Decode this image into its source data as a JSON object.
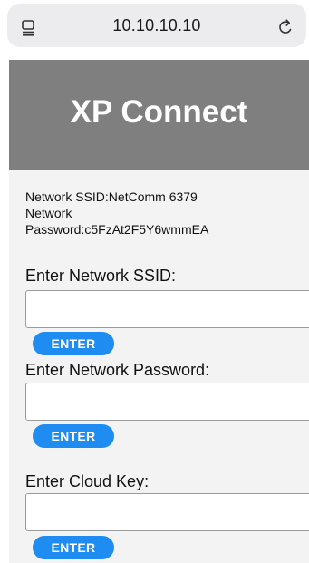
{
  "browser": {
    "url": "10.10.10.10",
    "tab_icon": "tabs-icon",
    "reload_icon": "reload-icon"
  },
  "header": {
    "title": "XP Connect"
  },
  "info": {
    "ssid_line": "Network SSID:NetComm 6379",
    "password_line_1": "Network",
    "password_line_2": "Password:c5FzAt2F5Y6wmmEA"
  },
  "form": {
    "ssid": {
      "label": "Enter Network SSID:",
      "value": "",
      "button": "ENTER"
    },
    "password": {
      "label": "Enter Network Password:",
      "value": "",
      "button": "ENTER"
    },
    "cloud_key": {
      "label": "Enter Cloud Key:",
      "value": "",
      "button": "ENTER"
    }
  },
  "colors": {
    "header_bg": "#7f7f7f",
    "button_bg": "#1e8cf0",
    "page_bg": "#f3f3f3"
  }
}
